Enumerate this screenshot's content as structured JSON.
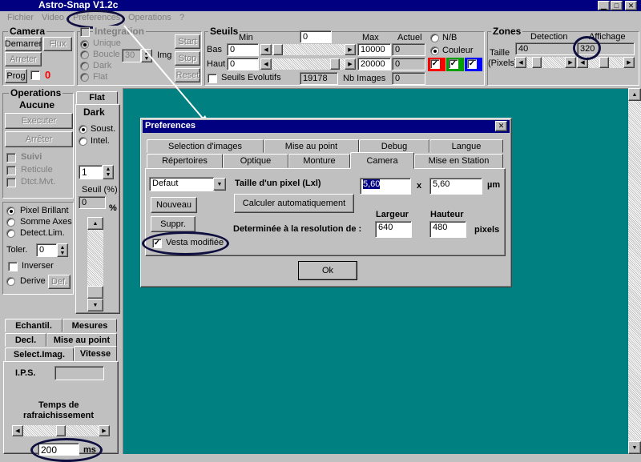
{
  "window_title": "Astro-Snap V1.2c",
  "menu": [
    "Fichier",
    "Video",
    "Preferences",
    "Operations",
    "?"
  ],
  "camera": {
    "title": "Camera",
    "demarrer": "Demarrer",
    "flux": "Flux",
    "arreter": "Arreter",
    "prog": "Prog",
    "count": "0"
  },
  "integration": {
    "title": "Integration",
    "unique": "Unique",
    "boucle": "Boucle",
    "boucle_value": "30",
    "img": "Img",
    "dark": "Dark",
    "flat": "Flat",
    "start": "Start",
    "stop": "Stop",
    "reset": "Reset"
  },
  "seuils": {
    "title": "Seuils",
    "min": "Min",
    "min_value": "0",
    "max": "Max",
    "actuel": "Actuel",
    "bas": "Bas",
    "bas_min": "0",
    "bas_max": "10000",
    "bas_actuel": "0",
    "haut": "Haut",
    "haut_min": "0",
    "haut_max": "20000",
    "haut_actuel": "0",
    "evolutifs": "Seuils Evolutifs",
    "evol_value": "19178",
    "nb_images": "Nb Images",
    "nb_value": "0",
    "nb": "N/B",
    "couleur": "Couleur"
  },
  "zones": {
    "title": "Zones",
    "detection": "Detection",
    "affichage": "Affichage",
    "taille": "Taille",
    "pixels": "(Pixels)",
    "det_value": "40",
    "aff_value": "320"
  },
  "operations": {
    "title": "Operations",
    "aucune": "Aucune",
    "executer": "Executer",
    "arreter": "Arrêter",
    "suivi": "Suivi",
    "reticule": "Reticule",
    "dtct": "Dtct.Mvt.",
    "pixel_brillant": "Pixel Brillant",
    "somme_axes": "Somme Axes",
    "detect_lim": "Detect.Lim.",
    "toler": "Toler.",
    "toler_value": "0",
    "inverser": "Inverser",
    "derive": "Derive",
    "def": "Def."
  },
  "flatdark": {
    "flat": "Flat",
    "dark": "Dark",
    "soust": "Soust.",
    "intel": "Intel.",
    "value": "1",
    "seuil": "Seuil (%)",
    "seuil_value": "0",
    "pct": "%"
  },
  "bottom_tabs": {
    "echantil": "Echantil.",
    "mesures": "Mesures",
    "decl": "Decl.",
    "mise_au_point": "Mise au point",
    "select_imag": "Select.Imag.",
    "vitesse": "Vitesse"
  },
  "vitesse": {
    "ips": "I.P.S.",
    "temps": "Temps de",
    "rafraich": "rafraichissement",
    "value": "200",
    "unit": "ms"
  },
  "dialog": {
    "title": "Preferences",
    "tabs_row1": [
      "Selection d'images",
      "Mise au point",
      "Debug",
      "Langue"
    ],
    "tabs_row2": [
      "Répertoires",
      "Optique",
      "Monture",
      "Camera",
      "Mise en Station"
    ],
    "preset": "Defaut",
    "nouveau": "Nouveau",
    "suppr": "Suppr.",
    "vesta": "Vesta modifiée",
    "taille_pixel": "Taille d'un pixel (Lxl)",
    "pixel_w": "5,60",
    "x": "x",
    "pixel_h": "5,60",
    "um": "µm",
    "calc": "Calculer automatiquement",
    "largeur": "Largeur",
    "hauteur": "Hauteur",
    "resolution": "Determinée à la resolution de :",
    "res_w": "640",
    "res_h": "480",
    "pixels": "pixels",
    "ok": "Ok"
  },
  "colors": {
    "titlebar": "#000080",
    "workspace": "#008080",
    "face": "#c0c0c0"
  }
}
